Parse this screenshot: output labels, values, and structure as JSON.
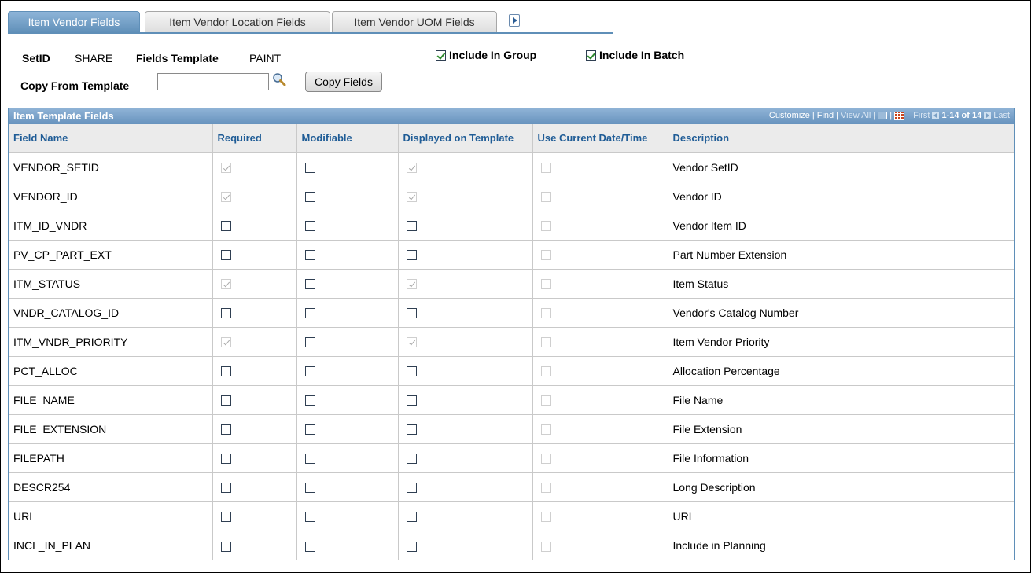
{
  "tabs": [
    {
      "label": "Item Vendor Fields",
      "active": true
    },
    {
      "label": "Item Vendor Location Fields",
      "active": false
    },
    {
      "label": "Item Vendor UOM Fields",
      "active": false
    }
  ],
  "header": {
    "setid_label": "SetID",
    "setid_value": "SHARE",
    "fields_template_label": "Fields Template",
    "fields_template_value": "PAINT",
    "include_in_group_label": "Include In Group",
    "include_in_group_checked": true,
    "include_in_batch_label": "Include In Batch",
    "include_in_batch_checked": true,
    "copy_from_template_label": "Copy From Template",
    "copy_from_template_value": "",
    "copy_fields_button": "Copy Fields"
  },
  "grid": {
    "title": "Item Template Fields",
    "nav": {
      "customize": "Customize",
      "find": "Find",
      "view_all": "View All",
      "first": "First",
      "count": "1-14 of 14",
      "last": "Last"
    },
    "columns": [
      "Field Name",
      "Required",
      "Modifiable",
      "Displayed on Template",
      "Use Current Date/Time",
      "Description"
    ],
    "rows": [
      {
        "field": "VENDOR_SETID",
        "required": [
          true,
          false
        ],
        "modifiable": false,
        "displayed": [
          true,
          false
        ],
        "usecurrent": false,
        "description": "Vendor SetID"
      },
      {
        "field": "VENDOR_ID",
        "required": [
          true,
          false
        ],
        "modifiable": false,
        "displayed": [
          true,
          false
        ],
        "usecurrent": false,
        "description": "Vendor ID"
      },
      {
        "field": "ITM_ID_VNDR",
        "required": [
          false,
          true
        ],
        "modifiable": false,
        "displayed": [
          false,
          true
        ],
        "usecurrent": false,
        "description": "Vendor Item ID"
      },
      {
        "field": "PV_CP_PART_EXT",
        "required": [
          false,
          true
        ],
        "modifiable": false,
        "displayed": [
          false,
          true
        ],
        "usecurrent": false,
        "description": "Part Number Extension"
      },
      {
        "field": "ITM_STATUS",
        "required": [
          true,
          false
        ],
        "modifiable": false,
        "displayed": [
          true,
          false
        ],
        "usecurrent": false,
        "description": "Item Status"
      },
      {
        "field": "VNDR_CATALOG_ID",
        "required": [
          false,
          true
        ],
        "modifiable": false,
        "displayed": [
          false,
          true
        ],
        "usecurrent": false,
        "description": "Vendor's Catalog Number"
      },
      {
        "field": "ITM_VNDR_PRIORITY",
        "required": [
          true,
          false
        ],
        "modifiable": false,
        "displayed": [
          true,
          false
        ],
        "usecurrent": false,
        "description": "Item Vendor Priority"
      },
      {
        "field": "PCT_ALLOC",
        "required": [
          false,
          true
        ],
        "modifiable": false,
        "displayed": [
          false,
          true
        ],
        "usecurrent": false,
        "description": "Allocation Percentage"
      },
      {
        "field": "FILE_NAME",
        "required": [
          false,
          true
        ],
        "modifiable": false,
        "displayed": [
          false,
          true
        ],
        "usecurrent": false,
        "description": "File Name"
      },
      {
        "field": "FILE_EXTENSION",
        "required": [
          false,
          true
        ],
        "modifiable": false,
        "displayed": [
          false,
          true
        ],
        "usecurrent": false,
        "description": "File Extension"
      },
      {
        "field": "FILEPATH",
        "required": [
          false,
          true
        ],
        "modifiable": false,
        "displayed": [
          false,
          true
        ],
        "usecurrent": false,
        "description": "File Information"
      },
      {
        "field": "DESCR254",
        "required": [
          false,
          true
        ],
        "modifiable": false,
        "displayed": [
          false,
          true
        ],
        "usecurrent": false,
        "description": "Long Description"
      },
      {
        "field": "URL",
        "required": [
          false,
          true
        ],
        "modifiable": false,
        "displayed": [
          false,
          true
        ],
        "usecurrent": false,
        "description": "URL"
      },
      {
        "field": "INCL_IN_PLAN",
        "required": [
          false,
          true
        ],
        "modifiable": false,
        "displayed": [
          false,
          true
        ],
        "usecurrent": false,
        "description": "Include in Planning"
      }
    ]
  },
  "colors": {
    "tab_active": "#5f8fb8",
    "grid_header_text": "#1f5c96",
    "check_green": "#2e8b2e"
  }
}
